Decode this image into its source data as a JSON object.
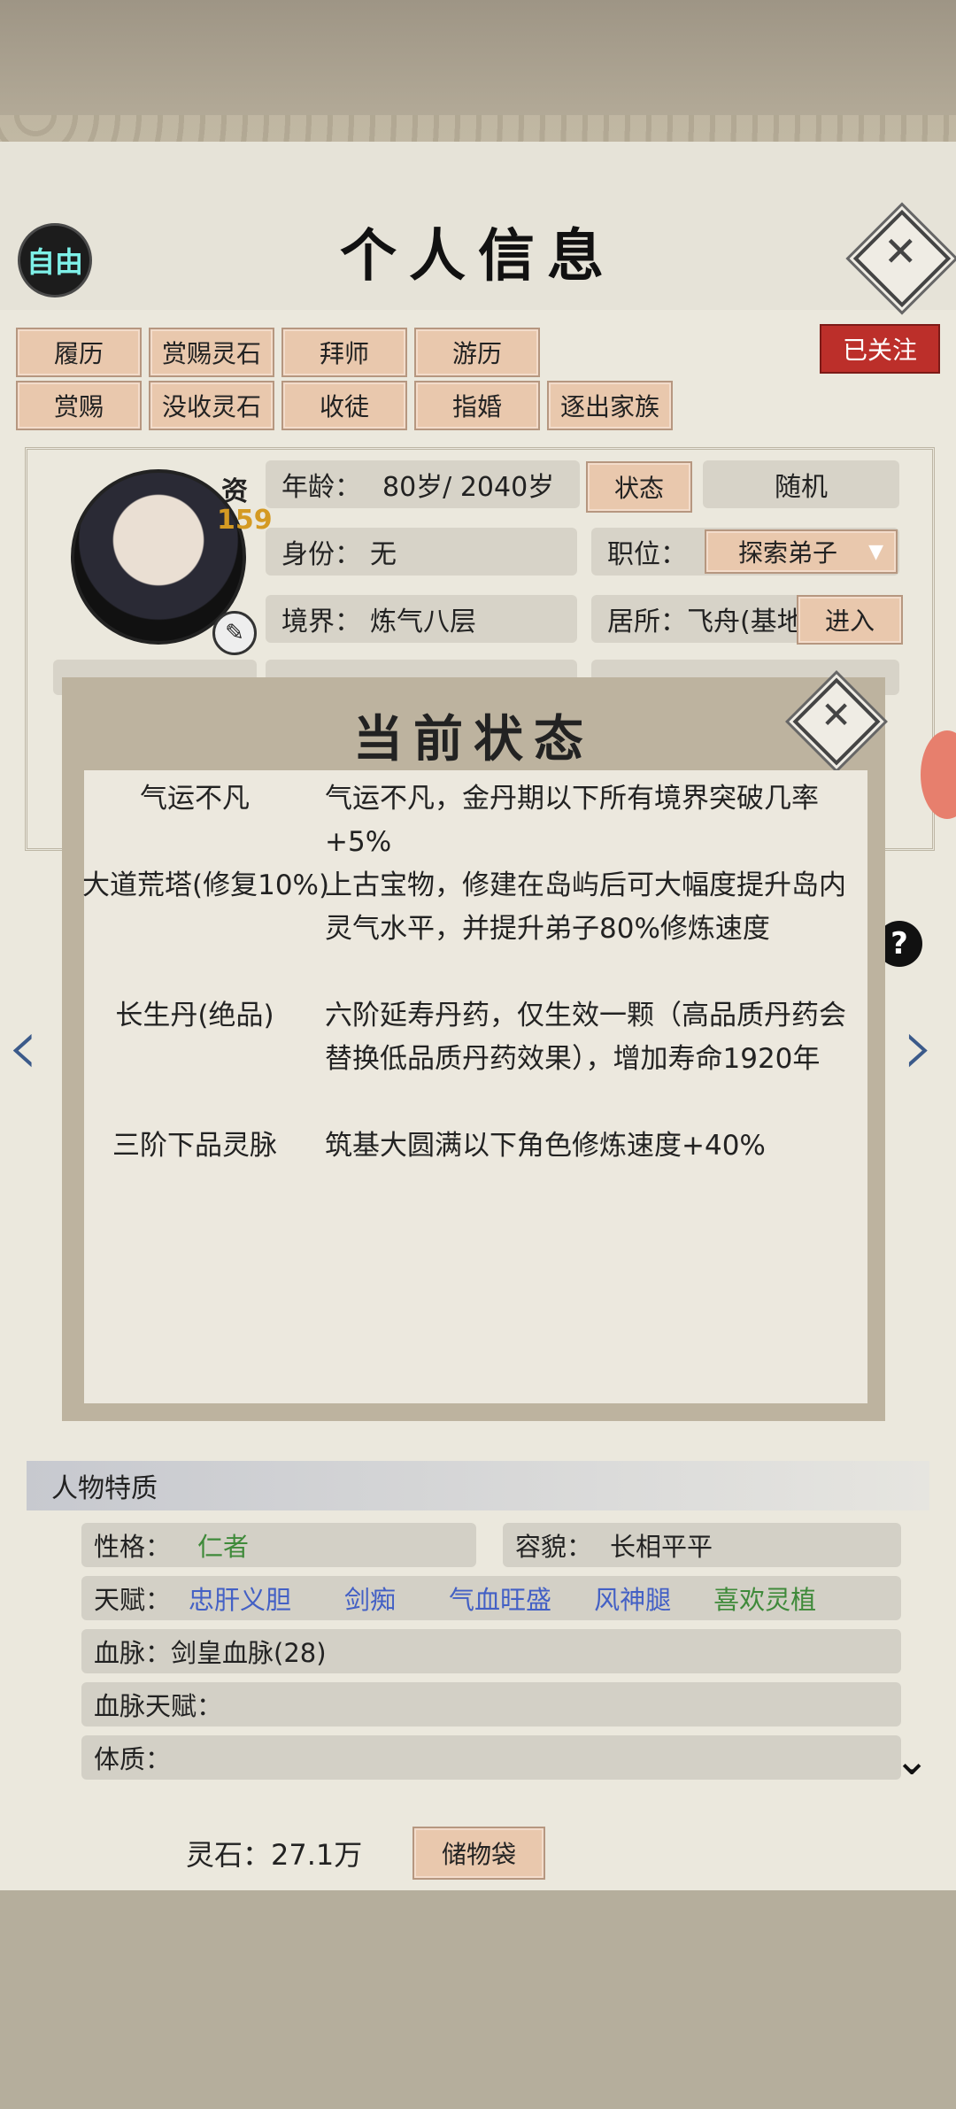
{
  "header": {
    "mode_badge": "自由",
    "title": "个人信息"
  },
  "actions_row1": [
    "履历",
    "赏赐灵石",
    "拜师",
    "游历"
  ],
  "actions_row2": [
    "赏赐",
    "没收灵石",
    "收徒",
    "指婚",
    "逐出家族"
  ],
  "follow_button": "已关注",
  "profile": {
    "zi_label": "资",
    "zi_value": "159",
    "age_label": "年龄：",
    "age_value": "80岁/ 2040岁",
    "status_button": "状态",
    "random_button": "随机",
    "identity_label": "身份：",
    "identity_value": "无",
    "position_label": "职位：",
    "position_value": "探索弟子",
    "realm_label": "境界：",
    "realm_value": "炼气八层",
    "residence_label": "居所：",
    "residence_value": "飞舟(基地",
    "enter_button": "进入"
  },
  "status_modal": {
    "title": "当前状态",
    "items": [
      {
        "name": "气运不凡",
        "desc": "气运不凡，金丹期以下所有境界突破几率+5%"
      },
      {
        "name": "大道荒塔(修复10%)",
        "desc": "上古宝物，修建在岛屿后可大幅度提升岛内灵气水平，并提升弟子80%修炼速度"
      },
      {
        "name": "长生丹(绝品)",
        "desc": "六阶延寿丹药，仅生效一颗（高品质丹药会替换低品质丹药效果），增加寿命1920年"
      },
      {
        "name": "三阶下品灵脉",
        "desc": "筑基大圆满以下角色修炼速度+40%"
      }
    ]
  },
  "traits": {
    "section_title": "人物特质",
    "personality_label": "性格：",
    "personality_value": "仁者",
    "looks_label": "容貌：",
    "looks_value": "长相平平",
    "talent_label": "天赋：",
    "talents": [
      {
        "text": "忠肝义胆",
        "color": "#4360c5"
      },
      {
        "text": "剑痴",
        "color": "#4360c5"
      },
      {
        "text": "气血旺盛",
        "color": "#4360c5"
      },
      {
        "text": "风神腿",
        "color": "#4360c5"
      },
      {
        "text": "喜欢灵植",
        "color": "#3f8a3a"
      }
    ],
    "bloodline_label": "血脉：",
    "bloodline_value": "剑皇血脉(28)",
    "bloodline_talent_label": "血脉天赋：",
    "physique_label": "体质："
  },
  "footer": {
    "spirit_stone": "灵石：27.1万",
    "storage_button": "储物袋"
  }
}
